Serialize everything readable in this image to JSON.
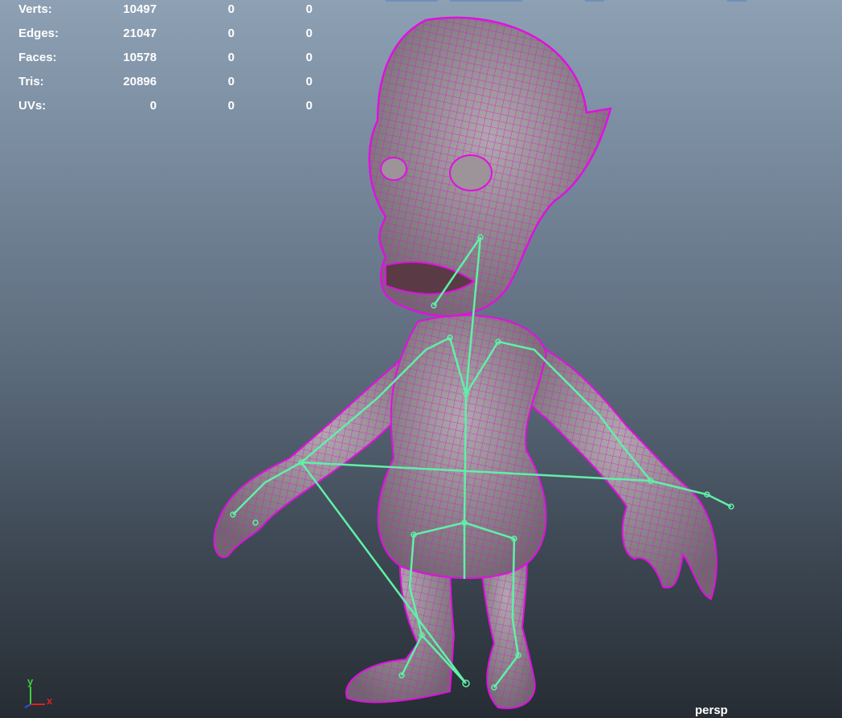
{
  "hud": {
    "rows": [
      {
        "label": "Verts:",
        "c1": "10497",
        "c2": "0",
        "c3": "0"
      },
      {
        "label": "Edges:",
        "c1": "21047",
        "c2": "0",
        "c3": "0"
      },
      {
        "label": "Faces:",
        "c1": "10578",
        "c2": "0",
        "c3": "0"
      },
      {
        "label": "Tris:",
        "c1": "20896",
        "c2": "0",
        "c3": "0"
      },
      {
        "label": "UVs:",
        "c1": "0",
        "c2": "0",
        "c3": "0"
      }
    ]
  },
  "axis": {
    "y_label": "y",
    "x_label": "x",
    "y_color": "#3dd23d",
    "x_color": "#e02020",
    "z_color": "#3050e0"
  },
  "camera": {
    "label": "persp"
  },
  "colors": {
    "mesh_fill": "#8a8488",
    "wireframe": "#e010e0",
    "skeleton": "#60f0a8"
  }
}
